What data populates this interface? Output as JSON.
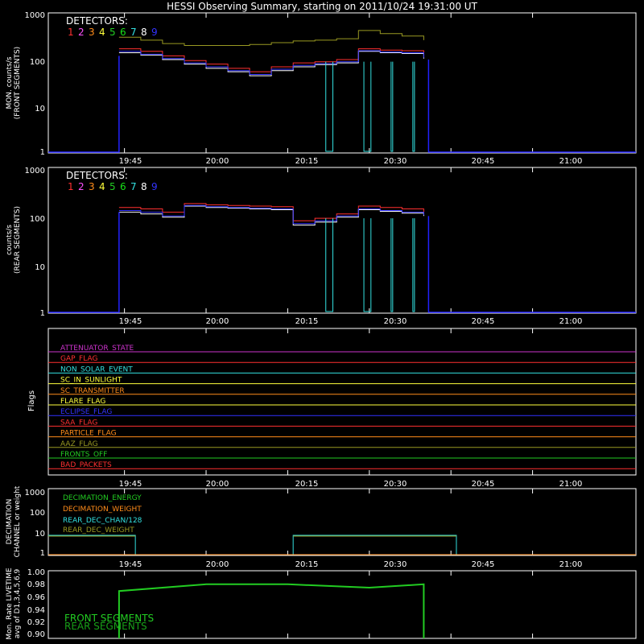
{
  "title": "HESSI Observing Summary, starting on 2011/10/24 19:31:00 UT",
  "colors": {
    "background": "#000000",
    "axes": "#ffffff",
    "det1": "#ff3030",
    "det2": "#ff50ff",
    "det3": "#ff8c1a",
    "det4": "#ffff3c",
    "det5": "#22cc22",
    "det6": "#18e018",
    "det7": "#33e0e0",
    "det8": "#ffffff",
    "det9": "#3333ff",
    "envelope": "#999922",
    "cyan_step": "#33e0e0",
    "blue_base": "#2222ff"
  },
  "time_ticks": [
    "19:45",
    "20:00",
    "20:15",
    "20:30",
    "20:45",
    "21:00"
  ],
  "detectors_label": "DETECTORS:",
  "detector_numbers": [
    "1",
    "2",
    "3",
    "4",
    "5",
    "6",
    "7",
    "8",
    "9"
  ],
  "chart_data": [
    {
      "type": "line",
      "ylabel": "MON. counts/s",
      "ylabel2": "(FRONT SEGMENTS)",
      "yscale": "log",
      "ylim": [
        1,
        1000
      ],
      "ytick_labels": [
        "1",
        "10",
        "100",
        "1000"
      ],
      "xlim": [
        "19:31",
        "21:19"
      ],
      "x": [
        "19:44",
        "19:48",
        "19:52",
        "19:56",
        "20:00",
        "20:04",
        "20:08",
        "20:12",
        "20:16",
        "20:20",
        "20:24",
        "20:28",
        "20:32",
        "20:36",
        "20:40"
      ],
      "series": [
        {
          "name": "1",
          "values": [
            170,
            150,
            120,
            95,
            80,
            65,
            55,
            70,
            85,
            90,
            100,
            170,
            160,
            155,
            120
          ]
        },
        {
          "name": "8",
          "values": [
            140,
            125,
            100,
            80,
            65,
            55,
            45,
            58,
            70,
            78,
            85,
            150,
            140,
            135,
            105
          ]
        },
        {
          "name": "9",
          "values": [
            150,
            130,
            105,
            85,
            70,
            58,
            48,
            62,
            75,
            82,
            90,
            155,
            145,
            140,
            110
          ]
        },
        {
          "name": "envelope",
          "values": [
            300,
            260,
            220,
            200,
            200,
            200,
            210,
            230,
            250,
            260,
            280,
            420,
            360,
            320,
            260
          ]
        }
      ]
    },
    {
      "type": "line",
      "ylabel": "counts/s",
      "ylabel2": "(REAR SEGMENTS)",
      "yscale": "log",
      "ylim": [
        1,
        1000
      ],
      "ytick_labels": [
        "1",
        "10",
        "100",
        "1000"
      ],
      "xlim": [
        "19:31",
        "21:19"
      ],
      "x": [
        "19:44",
        "19:48",
        "19:52",
        "19:56",
        "20:00",
        "20:04",
        "20:08",
        "20:12",
        "20:16",
        "20:20",
        "20:24",
        "20:28",
        "20:32",
        "20:36",
        "20:40"
      ],
      "series": [
        {
          "name": "1",
          "values": [
            150,
            140,
            120,
            180,
            170,
            165,
            160,
            155,
            80,
            90,
            110,
            160,
            150,
            140,
            120
          ]
        },
        {
          "name": "8",
          "values": [
            120,
            110,
            95,
            160,
            150,
            145,
            140,
            135,
            65,
            75,
            95,
            135,
            125,
            115,
            100
          ]
        },
        {
          "name": "9",
          "values": [
            130,
            120,
            100,
            165,
            155,
            150,
            145,
            140,
            70,
            80,
            100,
            140,
            130,
            120,
            105
          ]
        }
      ]
    },
    {
      "type": "table",
      "ylabel": "Flags",
      "flags": [
        {
          "label": "ATTENUATOR_STATE",
          "color": "#cc33cc"
        },
        {
          "label": "GAP_FLAG",
          "color": "#ff3030"
        },
        {
          "label": "NON_SOLAR_EVENT",
          "color": "#33e0e0"
        },
        {
          "label": "SC_IN_SUNLIGHT",
          "color": "#ffff3c"
        },
        {
          "label": "SC_TRANSMITTER",
          "color": "#ff8c1a"
        },
        {
          "label": "FLARE_FLAG",
          "color": "#ffff3c"
        },
        {
          "label": "ECLIPSE_FLAG",
          "color": "#3333ff"
        },
        {
          "label": "SAA_FLAG",
          "color": "#ff3030"
        },
        {
          "label": "PARTICLE_FLAG",
          "color": "#ff8c1a"
        },
        {
          "label": "AAZ_FLAG",
          "color": "#999922"
        },
        {
          "label": "FRONTS_OFF",
          "color": "#22cc22"
        },
        {
          "label": "BAD_PACKETS",
          "color": "#ff3030"
        }
      ]
    },
    {
      "type": "line",
      "ylabel": "DECIMATION",
      "ylabel2": "CHANNEL or weight",
      "yscale": "log",
      "ytick_labels": [
        "1",
        "10",
        "100",
        "1000"
      ],
      "legend": [
        {
          "label": "DECIMATION_ENERGY",
          "color": "#22cc22"
        },
        {
          "label": "DECIMATION_WEIGHT",
          "color": "#ff8c1a"
        },
        {
          "label": "REAR_DEC_CHAN/128",
          "color": "#33e0e0"
        },
        {
          "label": "REAR_DEC_WEIGHT",
          "color": "#999922"
        }
      ]
    },
    {
      "type": "line",
      "ylabel": "Mon. Rate LIVETIME",
      "ylabel2": "avg of D1,3,4,5,6,9",
      "ylim": [
        0.9,
        1.0
      ],
      "ytick_labels": [
        "0.90",
        "0.92",
        "0.94",
        "0.96",
        "0.98",
        "1.00"
      ],
      "legend": [
        {
          "label": "FRONT SEGMENTS",
          "color": "#22cc22"
        },
        {
          "label": "REAR SEGMENTS",
          "color": "#18a018"
        }
      ],
      "x": [
        "19:44",
        "20:00",
        "20:15",
        "20:30",
        "20:40"
      ],
      "values": [
        0.97,
        0.98,
        0.98,
        0.975,
        0.98
      ]
    }
  ]
}
